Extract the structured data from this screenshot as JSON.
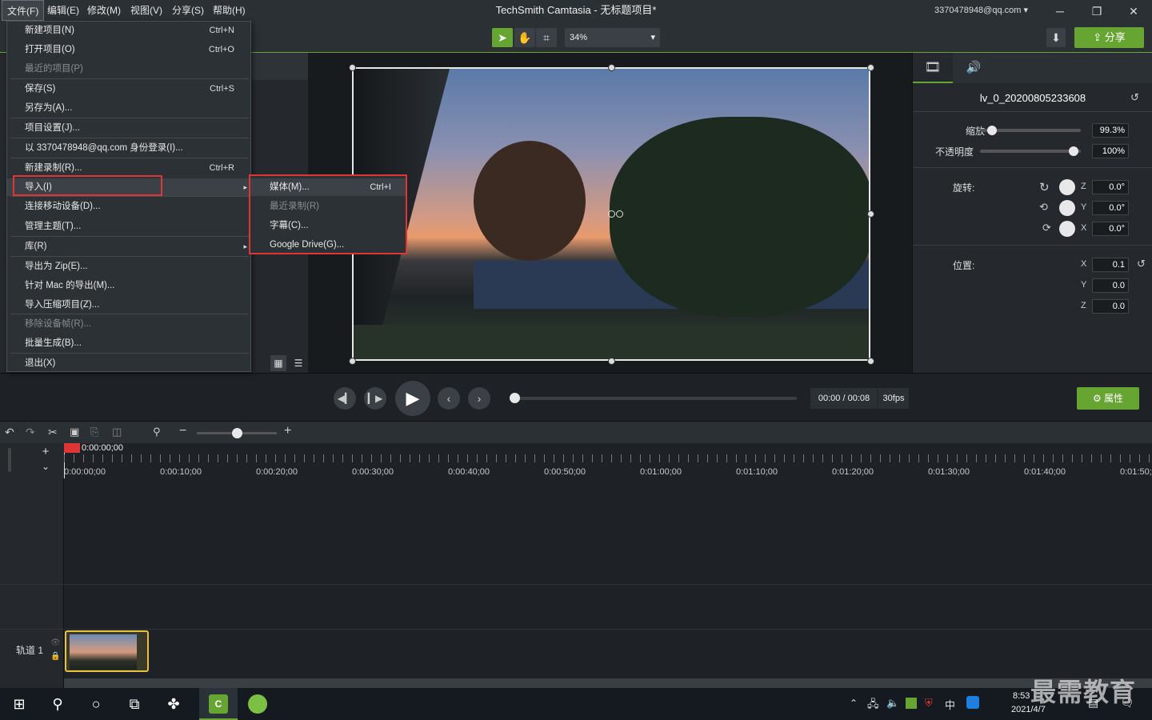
{
  "menu_bar": [
    "文件(F)",
    "编辑(E)",
    "修改(M)",
    "视图(V)",
    "分享(S)",
    "帮助(H)"
  ],
  "app_title": "TechSmith Camtasia - 无标题项目*",
  "account": "3370478948@qq.com",
  "toolbar": {
    "zoom": "34%",
    "share_label": "分享"
  },
  "file_menu": [
    {
      "label": "新建项目(N)",
      "shortcut": "Ctrl+N"
    },
    {
      "label": "打开项目(O)",
      "shortcut": "Ctrl+O"
    },
    {
      "label": "最近的项目(P)",
      "shortcut": ""
    },
    {
      "label": "保存(S)",
      "shortcut": "Ctrl+S"
    },
    {
      "label": "另存为(A)...",
      "shortcut": ""
    },
    {
      "label": "项目设置(J)...",
      "shortcut": ""
    },
    {
      "label": "以 3370478948@qq.com 身份登录(I)...",
      "shortcut": ""
    },
    {
      "label": "新建录制(R)...",
      "shortcut": "Ctrl+R"
    },
    {
      "label": "导入(I)",
      "shortcut": ""
    },
    {
      "label": "连接移动设备(D)...",
      "shortcut": ""
    },
    {
      "label": "管理主题(T)...",
      "shortcut": ""
    },
    {
      "label": "库(R)",
      "shortcut": ""
    },
    {
      "label": "导出为 Zip(E)...",
      "shortcut": ""
    },
    {
      "label": "针对 Mac 的导出(M)...",
      "shortcut": ""
    },
    {
      "label": "导入压缩项目(Z)...",
      "shortcut": ""
    },
    {
      "label": "移除设备帧(R)...",
      "shortcut": ""
    },
    {
      "label": "批量生成(B)...",
      "shortcut": ""
    },
    {
      "label": "退出(X)",
      "shortcut": ""
    }
  ],
  "import_submenu": [
    {
      "label": "媒体(M)...",
      "shortcut": "Ctrl+I"
    },
    {
      "label": "最近录制(R)",
      "shortcut": ""
    },
    {
      "label": "字幕(C)...",
      "shortcut": ""
    },
    {
      "label": "Google Drive(G)...",
      "shortcut": ""
    }
  ],
  "properties": {
    "clip_name": "lv_0_20200805233608",
    "scale_label": "缩放",
    "scale_value": "99.3%",
    "opacity_label": "不透明度",
    "opacity_value": "100%",
    "rotation_label": "旋转:",
    "rot_z": "0.0°",
    "rot_y": "0.0°",
    "rot_x": "0.0°",
    "position_label": "位置:",
    "pos_x": "0.1",
    "pos_y": "0.0",
    "pos_z": "0.0",
    "axis_z": "Z",
    "axis_y": "Y",
    "axis_x": "X",
    "props_button": "属性",
    "scale_level": 0.08,
    "opacity_level": 0.97
  },
  "playback": {
    "time": "00:00 / 00:08",
    "fps": "30fps"
  },
  "timeline": {
    "playhead_time": "0:00:00;00",
    "ticks": [
      "0:00:00;00",
      "0:00:10;00",
      "0:00:20;00",
      "0:00:30;00",
      "0:00:40;00",
      "0:00:50;00",
      "0:01:00;00",
      "0:01:10;00",
      "0:01:20;00",
      "0:01:30;00",
      "0:01:40;00",
      "0:01:50;"
    ],
    "track_label": "轨道 1"
  },
  "taskbar": {
    "clock_time": "8:53",
    "clock_date": "2021/4/7",
    "ime": "中"
  },
  "watermark": "最需教育"
}
